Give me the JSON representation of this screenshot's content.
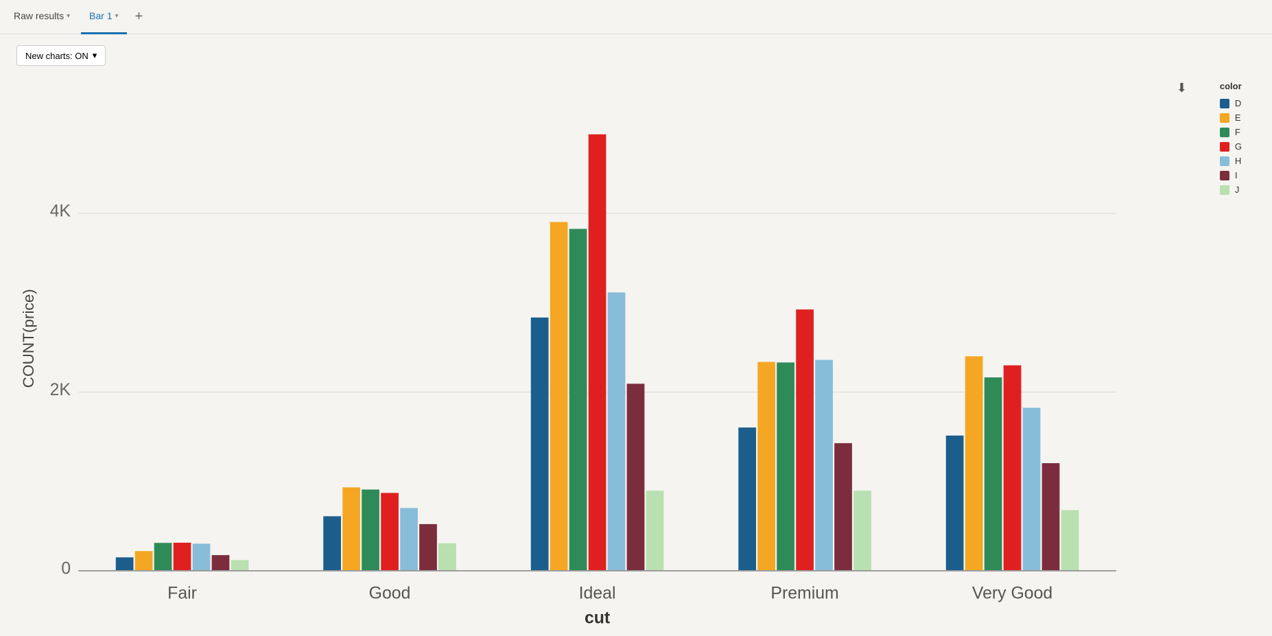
{
  "tabs": [
    {
      "id": "raw-results",
      "label": "Raw results",
      "active": false
    },
    {
      "id": "bar1",
      "label": "Bar 1",
      "active": true
    }
  ],
  "toolbar": {
    "new_charts_label": "New charts: ON",
    "chevron": "▾"
  },
  "legend": {
    "title": "color",
    "items": [
      {
        "key": "D",
        "color": "#1b5e8c"
      },
      {
        "key": "E",
        "color": "#f5a623"
      },
      {
        "key": "F",
        "color": "#2e8b57"
      },
      {
        "key": "G",
        "color": "#e02020"
      },
      {
        "key": "H",
        "color": "#87bdd8"
      },
      {
        "key": "I",
        "color": "#7b2d3e"
      },
      {
        "key": "J",
        "color": "#b8e0b0"
      }
    ]
  },
  "chart": {
    "y_axis_label": "COUNT(price)",
    "x_axis_label": "cut",
    "y_ticks": [
      "0",
      "2K",
      "4K"
    ],
    "categories": [
      "Fair",
      "Good",
      "Ideal",
      "Premium",
      "Very Good"
    ],
    "series": {
      "D": {
        "color": "#1b5e8c",
        "values": [
          150,
          610,
          2834,
          1603,
          1513
        ]
      },
      "E": {
        "color": "#f5a623",
        "values": [
          220,
          933,
          3903,
          2337,
          2400
        ]
      },
      "F": {
        "color": "#2e8b57",
        "values": [
          312,
          909,
          3826,
          2331,
          2164
        ]
      },
      "G": {
        "color": "#e02020",
        "values": [
          314,
          871,
          4884,
          2924,
          2299
        ]
      },
      "H": {
        "color": "#87bdd8",
        "values": [
          303,
          702,
          3115,
          2360,
          1824
        ]
      },
      "I": {
        "color": "#7b2d3e",
        "values": [
          175,
          522,
          2093,
          1428,
          1204
        ]
      },
      "J": {
        "color": "#b8e0b0",
        "values": [
          119,
          307,
          896,
          896,
          678
        ]
      }
    },
    "max_value": 5200
  }
}
